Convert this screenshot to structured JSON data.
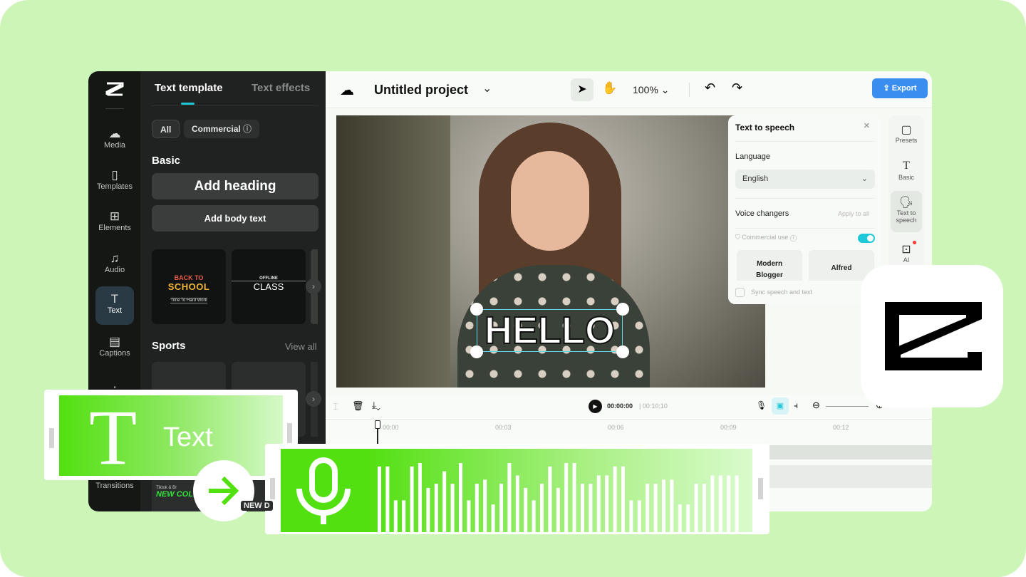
{
  "colors": {
    "background": "#cdf5b8",
    "accent": "#1fc8d8",
    "export": "#3a8ef0",
    "clip_green": "#52e010"
  },
  "rail": {
    "items": [
      {
        "label": "Media",
        "icon": "cloud-upload-icon"
      },
      {
        "label": "Templates",
        "icon": "templates-icon"
      },
      {
        "label": "Elements",
        "icon": "elements-icon"
      },
      {
        "label": "Audio",
        "icon": "music-icon"
      },
      {
        "label": "Text",
        "icon": "text-icon",
        "active": true
      },
      {
        "label": "Captions",
        "icon": "captions-icon"
      },
      {
        "label": "Transitions",
        "icon": "transitions-icon"
      }
    ]
  },
  "panel": {
    "tabs": [
      {
        "label": "Text template",
        "active": true
      },
      {
        "label": "Text effects"
      }
    ],
    "filters": [
      "All",
      "Commercial"
    ],
    "basic_heading": "Basic",
    "add_heading": "Add heading",
    "add_body": "Add body text",
    "thumbs": [
      {
        "top": "BACK TO",
        "main": "SCHOOL",
        "sub": "Time To Hard Work"
      },
      {
        "top": "OFFLINE",
        "main": "CLASS"
      }
    ],
    "sports_heading": "Sports",
    "view_all": "View all",
    "bottom_thumbs": [
      {
        "top": "Tiktok & Br",
        "main": "NEW COLLEC"
      },
      {
        "main": "NEW D"
      }
    ]
  },
  "topbar": {
    "title": "Untitled project",
    "zoom": "100%",
    "export": "Export"
  },
  "canvas": {
    "overlay_text": "HELLO"
  },
  "tts": {
    "title": "Text to speech",
    "language_label": "Language",
    "language_value": "English",
    "voice_changers": "Voice changers",
    "apply_all": "Apply to all",
    "commercial_use": "Commercial use",
    "commercial_on": true,
    "voices": [
      "Modern Blogger",
      "Alfred"
    ],
    "sync": "Sync speech and text"
  },
  "right_rail": [
    {
      "label": "Presets"
    },
    {
      "label": "Basic"
    },
    {
      "label": "Text to speech",
      "active": true
    },
    {
      "label": "AI"
    }
  ],
  "timeline": {
    "current": "00:00:00",
    "total": "00:10:10",
    "ticks": [
      "00:00",
      "00:03",
      "00:06",
      "00:09",
      "00:12"
    ]
  },
  "promo": {
    "text_clip_label": "Text",
    "waveform_levels": [
      0.95,
      0.95,
      0.46,
      0.46,
      0.95,
      1,
      0.64,
      0.7,
      0.88,
      0.7,
      1,
      0.46,
      0.7,
      0.76,
      0.4,
      0.7,
      1,
      0.82,
      0.64,
      0.46,
      0.7,
      0.95,
      0.64,
      1,
      1,
      0.7,
      0.7,
      0.82,
      0.82,
      0.95,
      0.95,
      0.46,
      0.46,
      0.7,
      0.7,
      0.76,
      0.76,
      0.4,
      0.4,
      0.7,
      0.7,
      0.82,
      0.82,
      0.82,
      0.82
    ]
  }
}
